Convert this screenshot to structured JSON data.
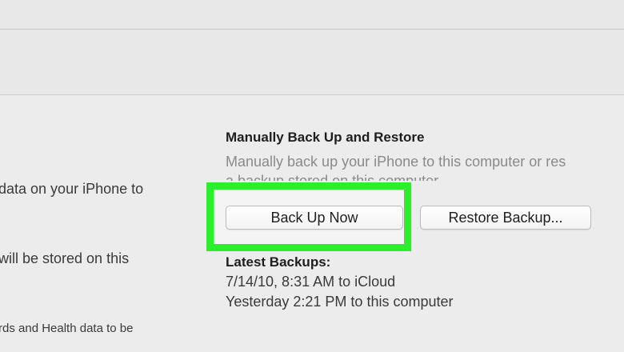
{
  "left_pane": {
    "line1": "data on your iPhone to",
    "line2": "will be stored on this",
    "line3": "rds and Health data to be"
  },
  "backup_section": {
    "title": "Manually Back Up and Restore",
    "description_line1": "Manually back up your iPhone to this computer or res",
    "description_line2": "a backup stored on this computer.",
    "back_up_now_label": "Back Up Now",
    "restore_backup_label": "Restore Backup...",
    "highlight_color": "#2bef2b"
  },
  "latest_backups": {
    "title": "Latest Backups:",
    "entries": [
      "7/14/10, 8:31 AM to iCloud",
      "Yesterday 2:21 PM to this computer"
    ]
  }
}
